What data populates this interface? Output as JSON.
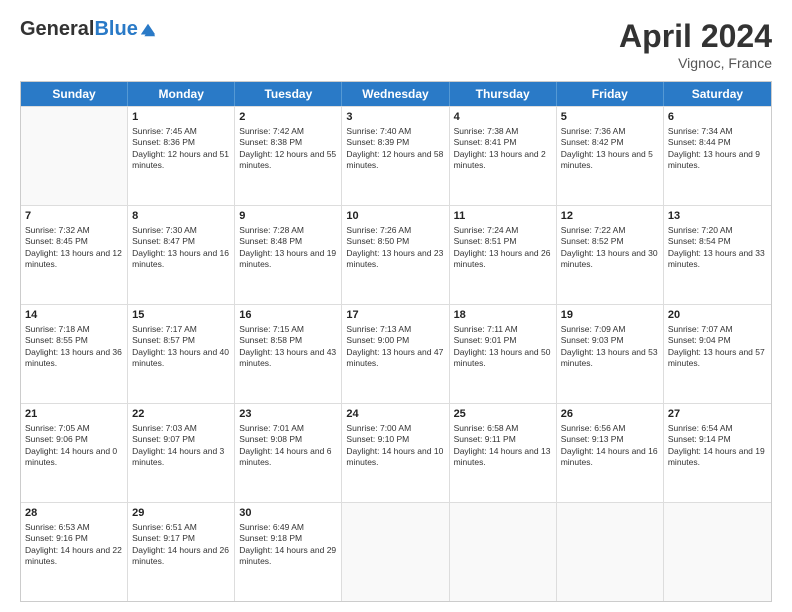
{
  "header": {
    "logo": {
      "general": "General",
      "blue": "Blue"
    },
    "title": "April 2024",
    "location": "Vignoc, France"
  },
  "weekdays": [
    "Sunday",
    "Monday",
    "Tuesday",
    "Wednesday",
    "Thursday",
    "Friday",
    "Saturday"
  ],
  "weeks": [
    [
      {
        "day": "",
        "sunrise": "",
        "sunset": "",
        "daylight": "",
        "empty": true
      },
      {
        "day": "1",
        "sunrise": "Sunrise: 7:45 AM",
        "sunset": "Sunset: 8:36 PM",
        "daylight": "Daylight: 12 hours and 51 minutes."
      },
      {
        "day": "2",
        "sunrise": "Sunrise: 7:42 AM",
        "sunset": "Sunset: 8:38 PM",
        "daylight": "Daylight: 12 hours and 55 minutes."
      },
      {
        "day": "3",
        "sunrise": "Sunrise: 7:40 AM",
        "sunset": "Sunset: 8:39 PM",
        "daylight": "Daylight: 12 hours and 58 minutes."
      },
      {
        "day": "4",
        "sunrise": "Sunrise: 7:38 AM",
        "sunset": "Sunset: 8:41 PM",
        "daylight": "Daylight: 13 hours and 2 minutes."
      },
      {
        "day": "5",
        "sunrise": "Sunrise: 7:36 AM",
        "sunset": "Sunset: 8:42 PM",
        "daylight": "Daylight: 13 hours and 5 minutes."
      },
      {
        "day": "6",
        "sunrise": "Sunrise: 7:34 AM",
        "sunset": "Sunset: 8:44 PM",
        "daylight": "Daylight: 13 hours and 9 minutes."
      }
    ],
    [
      {
        "day": "7",
        "sunrise": "Sunrise: 7:32 AM",
        "sunset": "Sunset: 8:45 PM",
        "daylight": "Daylight: 13 hours and 12 minutes."
      },
      {
        "day": "8",
        "sunrise": "Sunrise: 7:30 AM",
        "sunset": "Sunset: 8:47 PM",
        "daylight": "Daylight: 13 hours and 16 minutes."
      },
      {
        "day": "9",
        "sunrise": "Sunrise: 7:28 AM",
        "sunset": "Sunset: 8:48 PM",
        "daylight": "Daylight: 13 hours and 19 minutes."
      },
      {
        "day": "10",
        "sunrise": "Sunrise: 7:26 AM",
        "sunset": "Sunset: 8:50 PM",
        "daylight": "Daylight: 13 hours and 23 minutes."
      },
      {
        "day": "11",
        "sunrise": "Sunrise: 7:24 AM",
        "sunset": "Sunset: 8:51 PM",
        "daylight": "Daylight: 13 hours and 26 minutes."
      },
      {
        "day": "12",
        "sunrise": "Sunrise: 7:22 AM",
        "sunset": "Sunset: 8:52 PM",
        "daylight": "Daylight: 13 hours and 30 minutes."
      },
      {
        "day": "13",
        "sunrise": "Sunrise: 7:20 AM",
        "sunset": "Sunset: 8:54 PM",
        "daylight": "Daylight: 13 hours and 33 minutes."
      }
    ],
    [
      {
        "day": "14",
        "sunrise": "Sunrise: 7:18 AM",
        "sunset": "Sunset: 8:55 PM",
        "daylight": "Daylight: 13 hours and 36 minutes."
      },
      {
        "day": "15",
        "sunrise": "Sunrise: 7:17 AM",
        "sunset": "Sunset: 8:57 PM",
        "daylight": "Daylight: 13 hours and 40 minutes."
      },
      {
        "day": "16",
        "sunrise": "Sunrise: 7:15 AM",
        "sunset": "Sunset: 8:58 PM",
        "daylight": "Daylight: 13 hours and 43 minutes."
      },
      {
        "day": "17",
        "sunrise": "Sunrise: 7:13 AM",
        "sunset": "Sunset: 9:00 PM",
        "daylight": "Daylight: 13 hours and 47 minutes."
      },
      {
        "day": "18",
        "sunrise": "Sunrise: 7:11 AM",
        "sunset": "Sunset: 9:01 PM",
        "daylight": "Daylight: 13 hours and 50 minutes."
      },
      {
        "day": "19",
        "sunrise": "Sunrise: 7:09 AM",
        "sunset": "Sunset: 9:03 PM",
        "daylight": "Daylight: 13 hours and 53 minutes."
      },
      {
        "day": "20",
        "sunrise": "Sunrise: 7:07 AM",
        "sunset": "Sunset: 9:04 PM",
        "daylight": "Daylight: 13 hours and 57 minutes."
      }
    ],
    [
      {
        "day": "21",
        "sunrise": "Sunrise: 7:05 AM",
        "sunset": "Sunset: 9:06 PM",
        "daylight": "Daylight: 14 hours and 0 minutes."
      },
      {
        "day": "22",
        "sunrise": "Sunrise: 7:03 AM",
        "sunset": "Sunset: 9:07 PM",
        "daylight": "Daylight: 14 hours and 3 minutes."
      },
      {
        "day": "23",
        "sunrise": "Sunrise: 7:01 AM",
        "sunset": "Sunset: 9:08 PM",
        "daylight": "Daylight: 14 hours and 6 minutes."
      },
      {
        "day": "24",
        "sunrise": "Sunrise: 7:00 AM",
        "sunset": "Sunset: 9:10 PM",
        "daylight": "Daylight: 14 hours and 10 minutes."
      },
      {
        "day": "25",
        "sunrise": "Sunrise: 6:58 AM",
        "sunset": "Sunset: 9:11 PM",
        "daylight": "Daylight: 14 hours and 13 minutes."
      },
      {
        "day": "26",
        "sunrise": "Sunrise: 6:56 AM",
        "sunset": "Sunset: 9:13 PM",
        "daylight": "Daylight: 14 hours and 16 minutes."
      },
      {
        "day": "27",
        "sunrise": "Sunrise: 6:54 AM",
        "sunset": "Sunset: 9:14 PM",
        "daylight": "Daylight: 14 hours and 19 minutes."
      }
    ],
    [
      {
        "day": "28",
        "sunrise": "Sunrise: 6:53 AM",
        "sunset": "Sunset: 9:16 PM",
        "daylight": "Daylight: 14 hours and 22 minutes."
      },
      {
        "day": "29",
        "sunrise": "Sunrise: 6:51 AM",
        "sunset": "Sunset: 9:17 PM",
        "daylight": "Daylight: 14 hours and 26 minutes."
      },
      {
        "day": "30",
        "sunrise": "Sunrise: 6:49 AM",
        "sunset": "Sunset: 9:18 PM",
        "daylight": "Daylight: 14 hours and 29 minutes."
      },
      {
        "day": "",
        "sunrise": "",
        "sunset": "",
        "daylight": "",
        "empty": true
      },
      {
        "day": "",
        "sunrise": "",
        "sunset": "",
        "daylight": "",
        "empty": true
      },
      {
        "day": "",
        "sunrise": "",
        "sunset": "",
        "daylight": "",
        "empty": true
      },
      {
        "day": "",
        "sunrise": "",
        "sunset": "",
        "daylight": "",
        "empty": true
      }
    ]
  ]
}
